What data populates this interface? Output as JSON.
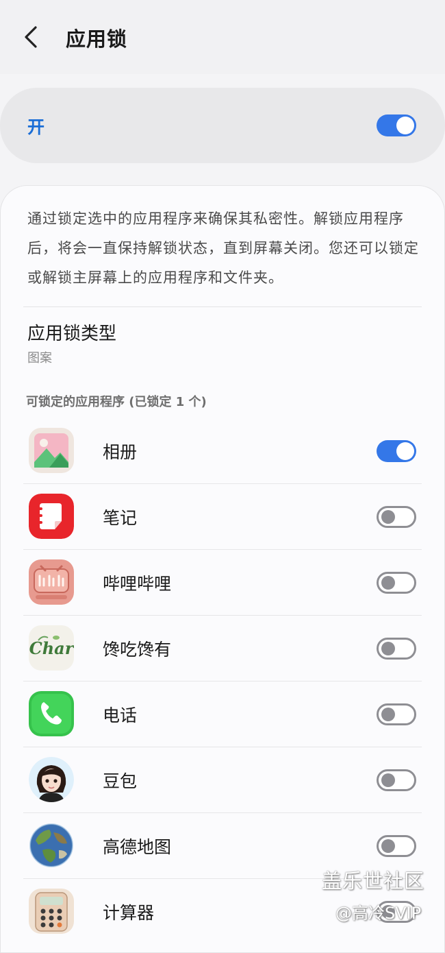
{
  "header": {
    "title": "应用锁",
    "back_icon": "chevron-left-icon"
  },
  "master": {
    "label": "开",
    "enabled": true,
    "accent": "#3477e8"
  },
  "description": "通过锁定选中的应用程序来确保其私密性。解锁应用程序后，将会一直保持解锁状态，直到屏幕关闭。您还可以锁定或解锁主屏幕上的应用程序和文件夹。",
  "lock_type": {
    "title": "应用锁类型",
    "value": "图案"
  },
  "apps_section": {
    "header": "可锁定的应用程序 (已锁定 1 个)",
    "apps": [
      {
        "name": "相册",
        "icon": "gallery-icon",
        "locked": true
      },
      {
        "name": "笔记",
        "icon": "notes-icon",
        "locked": false
      },
      {
        "name": "哔哩哔哩",
        "icon": "bilibili-icon",
        "locked": false
      },
      {
        "name": "馋吃馋有",
        "icon": "char-icon",
        "locked": false
      },
      {
        "name": "电话",
        "icon": "phone-icon",
        "locked": false
      },
      {
        "name": "豆包",
        "icon": "doubao-avatar-icon",
        "locked": false
      },
      {
        "name": "高德地图",
        "icon": "globe-icon",
        "locked": false
      },
      {
        "name": "计算器",
        "icon": "calculator-icon",
        "locked": false
      }
    ]
  },
  "watermark": {
    "line1": "盖乐世社区",
    "line2": "@高冷SVIP"
  }
}
